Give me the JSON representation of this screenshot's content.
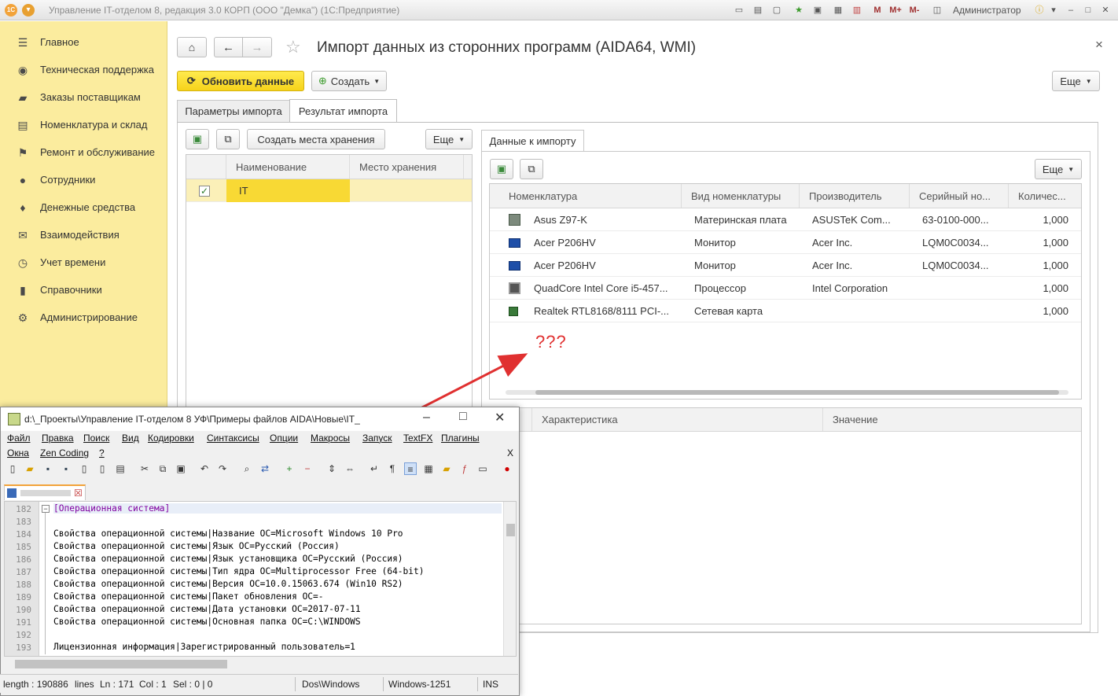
{
  "app": {
    "title": "Управление IT-отделом 8, редакция 3.0 КОРП (ООО \"Демка\") (1С:Предприятие)",
    "user": "Администратор",
    "logo_text": "1С",
    "mem_labels": [
      "M",
      "M+",
      "M-"
    ]
  },
  "sidebar": {
    "items": [
      {
        "label": "Главное",
        "icon": "menu-icon"
      },
      {
        "label": "Техническая поддержка",
        "icon": "support-icon"
      },
      {
        "label": "Заказы поставщикам",
        "icon": "truck-icon"
      },
      {
        "label": "Номенклатура и склад",
        "icon": "printer-icon"
      },
      {
        "label": "Ремонт и обслуживание",
        "icon": "flag-icon"
      },
      {
        "label": "Сотрудники",
        "icon": "people-icon"
      },
      {
        "label": "Денежные средства",
        "icon": "money-bag-icon"
      },
      {
        "label": "Взаимодействия",
        "icon": "envelope-icon"
      },
      {
        "label": "Учет времени",
        "icon": "clock-icon"
      },
      {
        "label": "Справочники",
        "icon": "book-icon"
      },
      {
        "label": "Администрирование",
        "icon": "gear-icon"
      }
    ]
  },
  "header": {
    "title": "Импорт данных из сторонних программ (AIDA64, WMI)",
    "close": "×"
  },
  "toolbar": {
    "refresh": "Обновить данные",
    "create": "Создать",
    "more": "Еще"
  },
  "tabs": {
    "params": "Параметры импорта",
    "result": "Результат импорта"
  },
  "left_panel": {
    "create_storage": "Создать места хранения",
    "more": "Еще",
    "columns": [
      "Наименование",
      "Место хранения"
    ],
    "rows": [
      {
        "checked": true,
        "name": "IT",
        "storage": ""
      }
    ]
  },
  "right_panel": {
    "tab": "Данные к импорту",
    "more": "Еще",
    "columns": [
      "Номенклатура",
      "Вид номенклатуры",
      "Производитель",
      "Серийный но...",
      "Количес..."
    ],
    "rows": [
      {
        "icon": "motherboard-icon",
        "name": "Asus Z97-K",
        "kind": "Материнская плата",
        "vendor": "ASUSTeK Com...",
        "serial": "63-0100-000...",
        "qty": "1,000"
      },
      {
        "icon": "monitor-icon",
        "name": "Acer P206HV",
        "kind": "Монитор",
        "vendor": "Acer Inc.",
        "serial": "LQM0C0034...",
        "qty": "1,000"
      },
      {
        "icon": "monitor-icon",
        "name": "Acer P206HV",
        "kind": "Монитор",
        "vendor": "Acer Inc.",
        "serial": "LQM0C0034...",
        "qty": "1,000"
      },
      {
        "icon": "cpu-icon",
        "name": "QuadCore Intel Core i5-457...",
        "kind": "Процессор",
        "vendor": "Intel Corporation",
        "serial": "",
        "qty": "1,000"
      },
      {
        "icon": "network-card-icon",
        "name": "Realtek RTL8168/8111 PCI-...",
        "kind": "Сетевая карта",
        "vendor": "",
        "serial": "",
        "qty": "1,000"
      }
    ],
    "annotation": "???",
    "char_columns": [
      "Характеристика",
      "Значение"
    ]
  },
  "notepad": {
    "title": "d:\\_Проекты\\Управление IT-отделом 8 УФ\\Примеры файлов AIDA\\Новые\\IT_",
    "menu_row1": [
      "Файл",
      "Правка",
      "Поиск",
      "Вид",
      "Кодировки",
      "Синтаксисы",
      "Опции",
      "Макросы",
      "Запуск",
      "TextFX",
      "Плагины"
    ],
    "menu_row2": [
      "Окна",
      "Zen Coding",
      "?"
    ],
    "menu_close": "X",
    "lines": [
      {
        "n": "182",
        "text": "[Операционная система]"
      },
      {
        "n": "183",
        "text": ""
      },
      {
        "n": "184",
        "text": "Свойства операционной системы|Название ОС=Microsoft Windows 10 Pro"
      },
      {
        "n": "185",
        "text": "Свойства операционной системы|Язык ОС=Русский (Россия)"
      },
      {
        "n": "186",
        "text": "Свойства операционной системы|Язык установщика ОС=Русский (Россия)"
      },
      {
        "n": "187",
        "text": "Свойства операционной системы|Тип ядра ОС=Multiprocessor Free (64-bit)"
      },
      {
        "n": "188",
        "text": "Свойства операционной системы|Версия ОС=10.0.15063.674 (Win10 RS2)"
      },
      {
        "n": "189",
        "text": "Свойства операционной системы|Пакет обновления ОС=-"
      },
      {
        "n": "190",
        "text": "Свойства операционной системы|Дата установки ОС=2017-07-11"
      },
      {
        "n": "191",
        "text": "Свойства операционной системы|Основная папка ОС=C:\\WINDOWS"
      },
      {
        "n": "192",
        "text": ""
      },
      {
        "n": "193",
        "text": "Лицензионная информация|Зарегистрированный пользователь=1"
      }
    ],
    "status": {
      "length": "length : 190886",
      "lines": "lines",
      "ln": "Ln : 171",
      "col": "Col : 1",
      "sel": "Sel : 0 | 0",
      "eol": "Dos\\Windows",
      "enc": "Windows-1251",
      "mode": "INS"
    }
  },
  "colors": {
    "accent_yellow": "#f6d31b",
    "sidebar_bg": "#fbec9e",
    "arrow_red": "#e03030",
    "selected_row": "#fbe27a"
  }
}
